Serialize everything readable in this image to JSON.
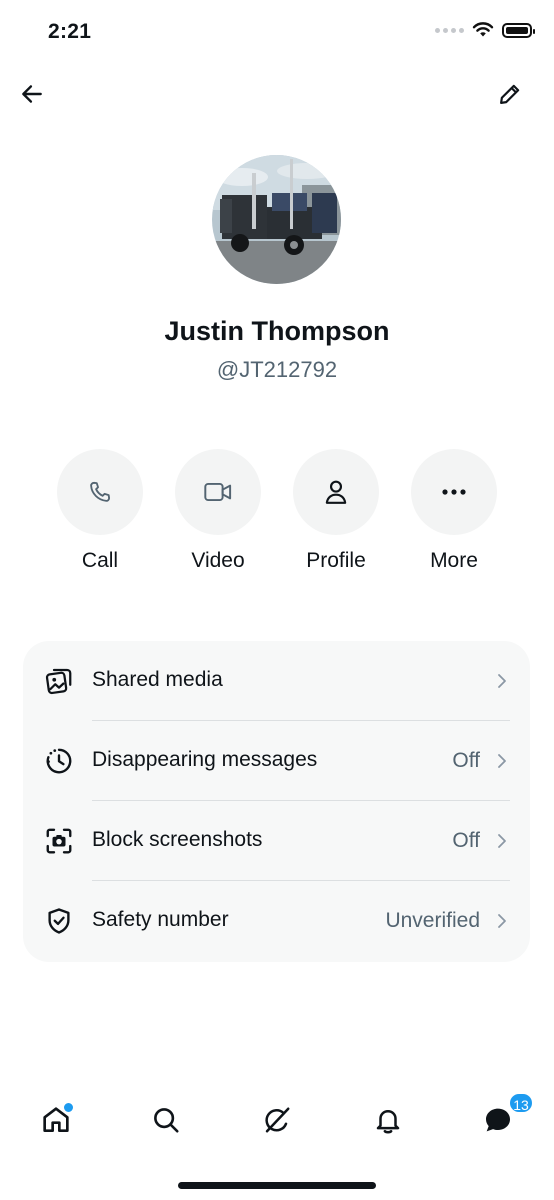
{
  "status_bar": {
    "time": "2:21"
  },
  "header": {
    "back_icon": "arrow-left-icon",
    "edit_icon": "pencil-icon"
  },
  "profile": {
    "name": "Justin Thompson",
    "handle": "@JT212792",
    "avatar_alt": "semi truck photo"
  },
  "actions": [
    {
      "label": "Call",
      "icon": "phone-icon"
    },
    {
      "label": "Video",
      "icon": "video-camera-icon"
    },
    {
      "label": "Profile",
      "icon": "person-icon"
    },
    {
      "label": "More",
      "icon": "more-dots-icon"
    }
  ],
  "settings": [
    {
      "label": "Shared media",
      "value": "",
      "icon": "shared-media-icon"
    },
    {
      "label": "Disappearing messages",
      "value": "Off",
      "icon": "timer-icon"
    },
    {
      "label": "Block screenshots",
      "value": "Off",
      "icon": "screenshot-camera-icon"
    },
    {
      "label": "Safety number",
      "value": "Unverified",
      "icon": "shield-check-icon"
    }
  ],
  "tabbar": {
    "items": [
      "home-icon",
      "search-icon",
      "grok-icon",
      "notifications-bell-icon",
      "messages-icon"
    ],
    "messages_badge": "13"
  },
  "colors": {
    "accent": "#1d9bf0",
    "card_bg": "#f7f8f8",
    "muted_text": "#536471",
    "circle_bg": "#f3f4f4"
  }
}
